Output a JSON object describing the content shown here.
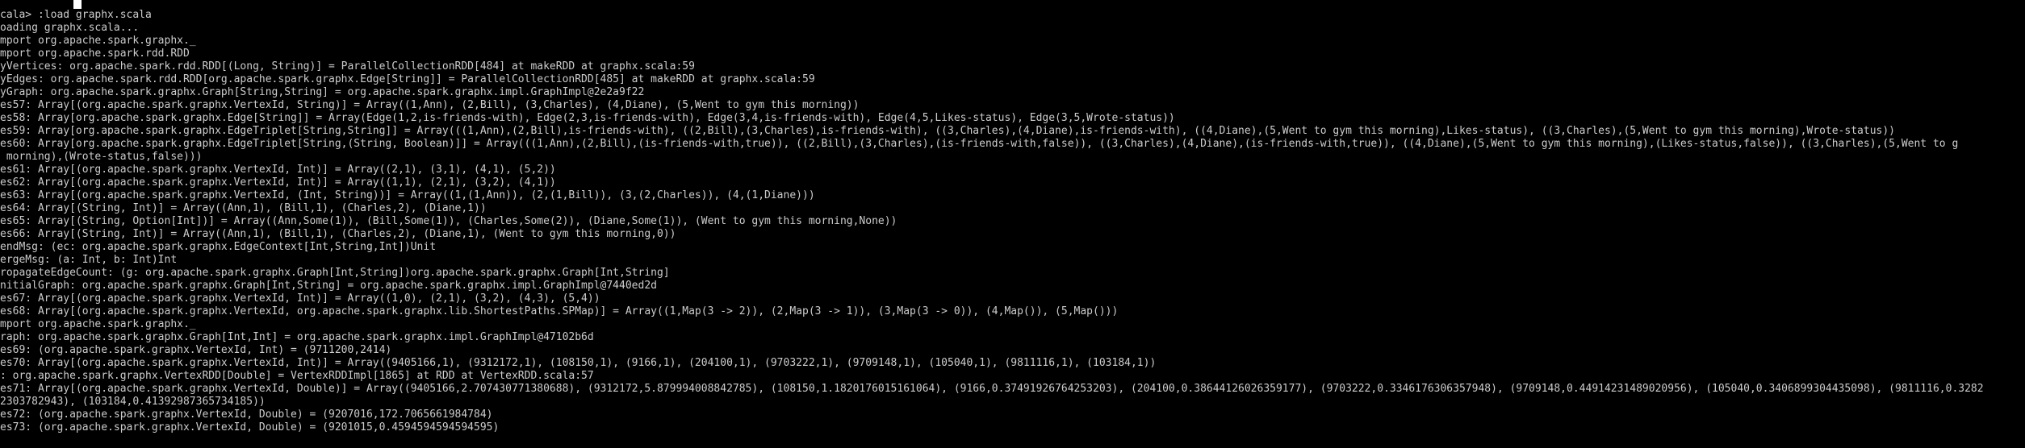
{
  "terminal": {
    "lines": [
      "cala> :load graphx.scala",
      "oading graphx.scala...",
      "mport org.apache.spark.graphx._",
      "mport org.apache.spark.rdd.RDD",
      "yVertices: org.apache.spark.rdd.RDD[(Long, String)] = ParallelCollectionRDD[484] at makeRDD at graphx.scala:59",
      "yEdges: org.apache.spark.rdd.RDD[org.apache.spark.graphx.Edge[String]] = ParallelCollectionRDD[485] at makeRDD at graphx.scala:59",
      "yGraph: org.apache.spark.graphx.Graph[String,String] = org.apache.spark.graphx.impl.GraphImpl@2e2a9f22",
      "es57: Array[(org.apache.spark.graphx.VertexId, String)] = Array((1,Ann), (2,Bill), (3,Charles), (4,Diane), (5,Went to gym this morning))",
      "es58: Array[org.apache.spark.graphx.Edge[String]] = Array(Edge(1,2,is-friends-with), Edge(2,3,is-friends-with), Edge(3,4,is-friends-with), Edge(4,5,Likes-status), Edge(3,5,Wrote-status))",
      "es59: Array[org.apache.spark.graphx.EdgeTriplet[String,String]] = Array(((1,Ann),(2,Bill),is-friends-with), ((2,Bill),(3,Charles),is-friends-with), ((3,Charles),(4,Diane),is-friends-with), ((4,Diane),(5,Went to gym this morning),Likes-status), ((3,Charles),(5,Went to gym this morning),Wrote-status))",
      "es60: Array[org.apache.spark.graphx.EdgeTriplet[String,(String, Boolean)]] = Array(((1,Ann),(2,Bill),(is-friends-with,true)), ((2,Bill),(3,Charles),(is-friends-with,false)), ((3,Charles),(4,Diane),(is-friends-with,true)), ((4,Diane),(5,Went to gym this morning),(Likes-status,false)), ((3,Charles),(5,Went to g",
      " morning),(Wrote-status,false)))",
      "es61: Array[(org.apache.spark.graphx.VertexId, Int)] = Array((2,1), (3,1), (4,1), (5,2))",
      "es62: Array[(org.apache.spark.graphx.VertexId, Int)] = Array((1,1), (2,1), (3,2), (4,1))",
      "es63: Array[(org.apache.spark.graphx.VertexId, (Int, String))] = Array((1,(1,Ann)), (2,(1,Bill)), (3,(2,Charles)), (4,(1,Diane)))",
      "es64: Array[(String, Int)] = Array((Ann,1), (Bill,1), (Charles,2), (Diane,1))",
      "es65: Array[(String, Option[Int])] = Array((Ann,Some(1)), (Bill,Some(1)), (Charles,Some(2)), (Diane,Some(1)), (Went to gym this morning,None))",
      "es66: Array[(String, Int)] = Array((Ann,1), (Bill,1), (Charles,2), (Diane,1), (Went to gym this morning,0))",
      "endMsg: (ec: org.apache.spark.graphx.EdgeContext[Int,String,Int])Unit",
      "ergeMsg: (a: Int, b: Int)Int",
      "ropagateEdgeCount: (g: org.apache.spark.graphx.Graph[Int,String])org.apache.spark.graphx.Graph[Int,String]",
      "nitialGraph: org.apache.spark.graphx.Graph[Int,String] = org.apache.spark.graphx.impl.GraphImpl@7440ed2d",
      "es67: Array[(org.apache.spark.graphx.VertexId, Int)] = Array((1,0), (2,1), (3,2), (4,3), (5,4))",
      "es68: Array[(org.apache.spark.graphx.VertexId, org.apache.spark.graphx.lib.ShortestPaths.SPMap)] = Array((1,Map(3 -> 2)), (2,Map(3 -> 1)), (3,Map(3 -> 0)), (4,Map()), (5,Map()))",
      "mport org.apache.spark.graphx._",
      "raph: org.apache.spark.graphx.Graph[Int,Int] = org.apache.spark.graphx.impl.GraphImpl@47102b6d",
      "es69: (org.apache.spark.graphx.VertexId, Int) = (9711200,2414)",
      "es70: Array[(org.apache.spark.graphx.VertexId, Int)] = Array((9405166,1), (9312172,1), (108150,1), (9166,1), (204100,1), (9703222,1), (9709148,1), (105040,1), (9811116,1), (103184,1))",
      ": org.apache.spark.graphx.VertexRDD[Double] = VertexRDDImpl[1865] at RDD at VertexRDD.scala:57",
      "es71: Array[(org.apache.spark.graphx.VertexId, Double)] = Array((9405166,2.707430771380688), (9312172,5.879994008842785), (108150,1.1820176015161064), (9166,0.37491926764253203), (204100,0.38644126026359177), (9703222,0.3346176306357948), (9709148,0.44914231489020956), (105040,0.3406899304435098), (9811116,0.3282",
      "2303782943), (103184,0.41392987365734185))",
      "es72: (org.apache.spark.graphx.VertexId, Double) = (9207016,172.7065661984784)",
      "es73: (org.apache.spark.graphx.VertexId, Double) = (9201015,0.4594594594594595)"
    ]
  }
}
